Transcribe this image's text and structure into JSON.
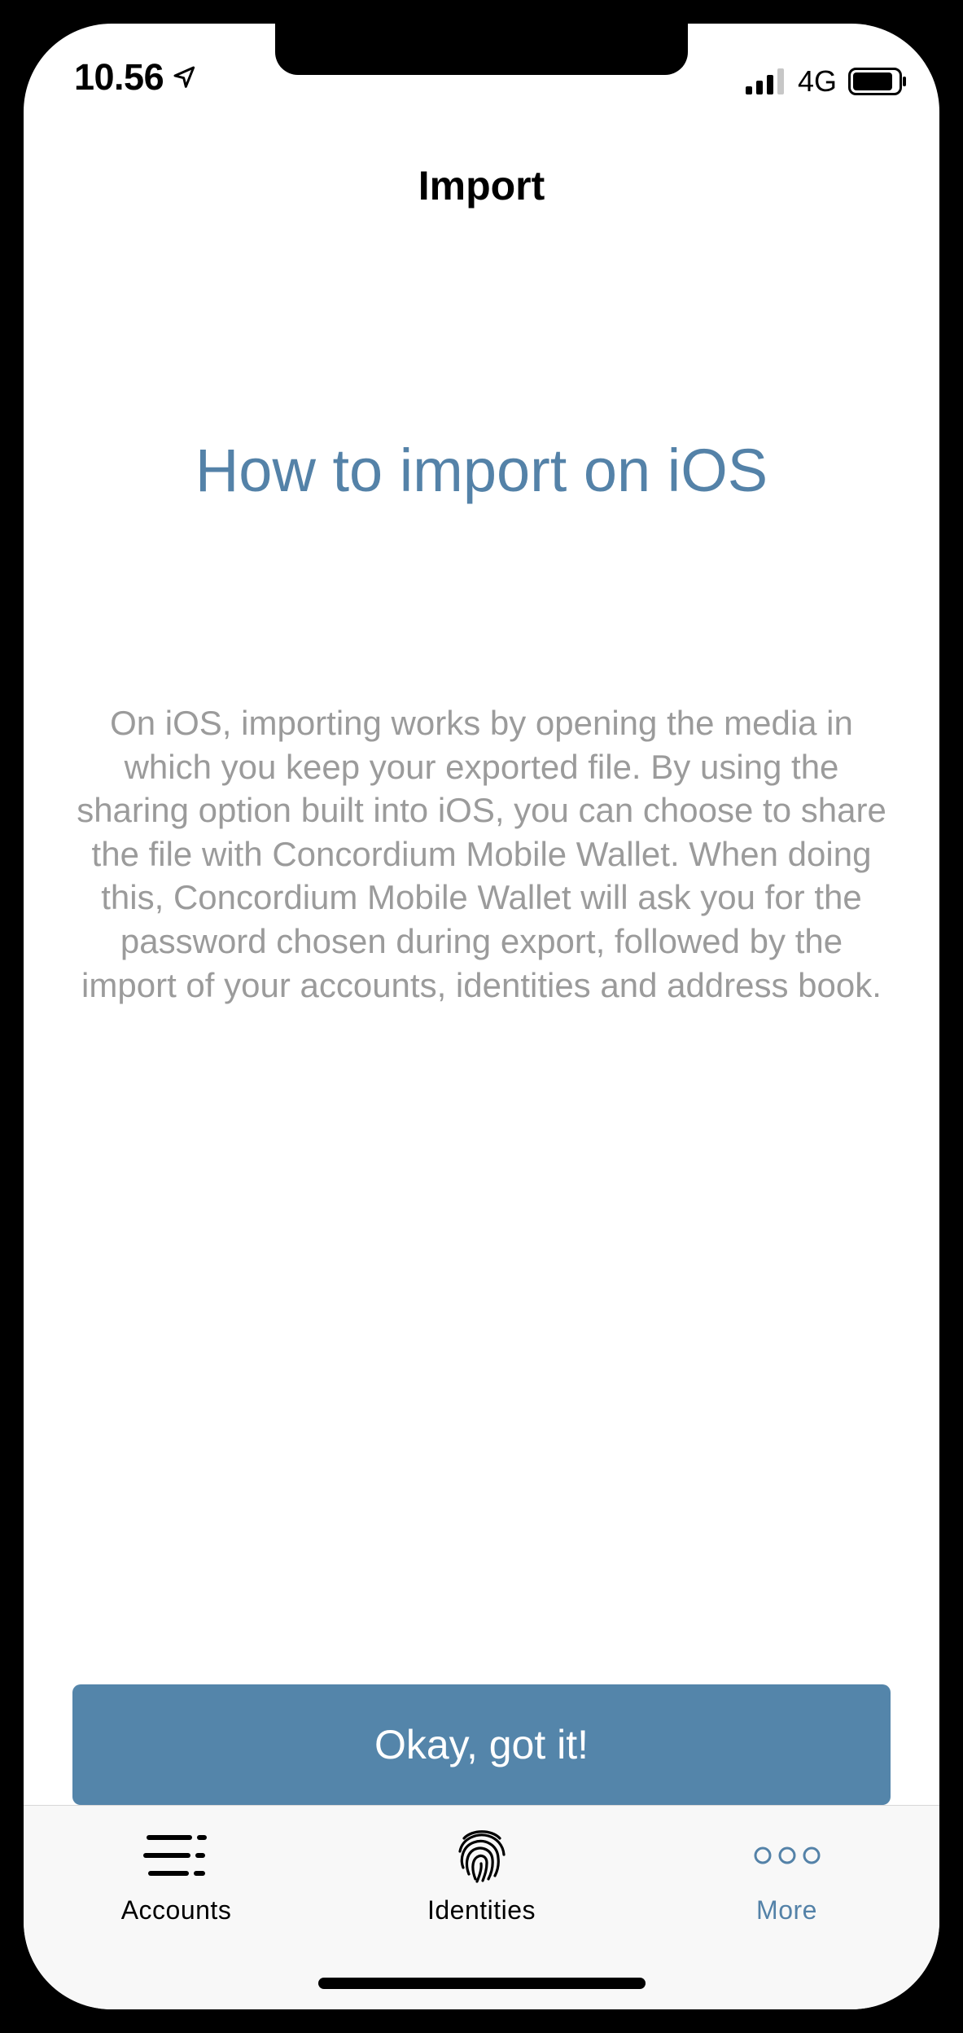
{
  "status_bar": {
    "time": "10.56",
    "network": "4G",
    "icons": [
      "location-arrow-icon",
      "cellular-signal-icon",
      "battery-icon"
    ]
  },
  "nav": {
    "title": "Import"
  },
  "content": {
    "heading": "How to import on iOS",
    "body": "On iOS, importing works by opening the media in which you keep your exported file. By using the sharing option built into iOS, you can choose to share the file with Concordium Mobile Wallet. When doing this, Concordium Mobile Wallet will ask you for the password chosen during export, followed by the import of your accounts, identities and address book."
  },
  "actions": {
    "ok_label": "Okay, got it!"
  },
  "tab_bar": {
    "selected": "More",
    "items": [
      {
        "label": "Accounts",
        "icon": "accounts-list-icon"
      },
      {
        "label": "Identities",
        "icon": "fingerprint-icon"
      },
      {
        "label": "More",
        "icon": "more-dots-icon"
      }
    ]
  },
  "colors": {
    "accent": "#5482a8",
    "button": "#5485aa",
    "body_text": "#9b9b9b",
    "tab_bar_bg": "#f8f8f8"
  }
}
